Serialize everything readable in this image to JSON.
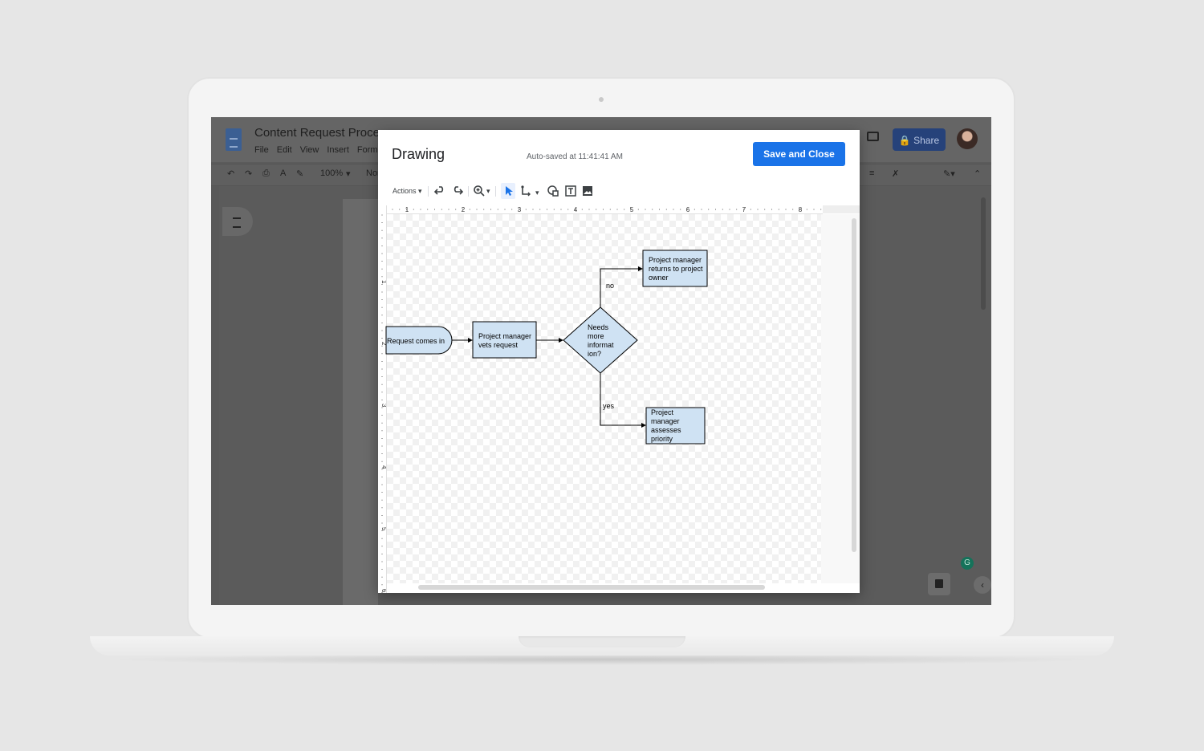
{
  "docs": {
    "title": "Content Request Process",
    "menu": [
      "File",
      "Edit",
      "View",
      "Insert",
      "Form"
    ],
    "zoom": "100%",
    "style_partial": "Nor",
    "share_label": "Share",
    "grammarly_letter": "G"
  },
  "dialog": {
    "title": "Drawing",
    "status": "Auto-saved at 11:41:41 AM",
    "save_label": "Save and Close",
    "actions_label": "Actions",
    "top_ruler_numbers": [
      "1",
      "2",
      "3",
      "4",
      "5",
      "6",
      "7",
      "8"
    ],
    "left_ruler_numbers": [
      "1",
      "2",
      "3",
      "4",
      "5",
      "6"
    ]
  },
  "flowchart": {
    "start": "Request comes in",
    "vet": [
      "Project manager",
      "vets request"
    ],
    "decision": [
      "Needs",
      "more",
      "informat",
      "ion?"
    ],
    "no_label": "no",
    "yes_label": "yes",
    "returns": [
      "Project manager",
      "returns to project",
      "owner"
    ],
    "assess": [
      "Project",
      "manager",
      "assesses",
      "priority"
    ]
  },
  "colors": {
    "accent": "#1a73e8",
    "shape_fill": "#cfe2f3"
  }
}
